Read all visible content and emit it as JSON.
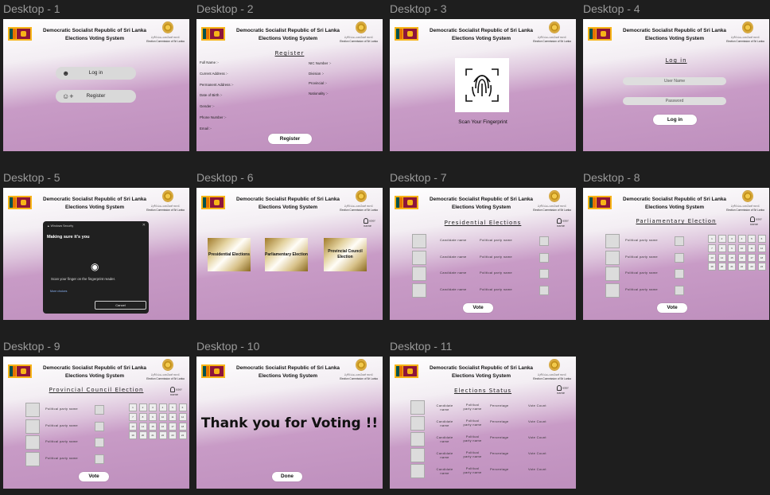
{
  "common": {
    "title_line1": "Democratic Socialist Republic of Sri Lanka",
    "title_line2": "Elections Voting System",
    "commission_si": "මැතිවරණ කොමිෂන් සභාව",
    "commission_en": "Election Commission of Sri Lanka",
    "user_label": "user name"
  },
  "colors": {
    "canvas": "#1e1e1e",
    "frame_top": "#ffffff",
    "frame_bottom": "#be8fbd",
    "label": "#9a9a9a"
  },
  "frames": {
    "d1": {
      "label": "Desktop - 1",
      "login": "Log in",
      "register": "Register",
      "login_icon": "user-icon",
      "register_icon": "add-user-icon"
    },
    "d2": {
      "label": "Desktop - 2",
      "heading": "Register",
      "left_fields": [
        "Full Name :-",
        "Current Address :-",
        "Permanent Address :-",
        "Date of Birth :-",
        "Gender :-",
        "Phone Number :-",
        "Email :-"
      ],
      "right_fields": [
        "NIC Number :-",
        "Division :-",
        "Provincial :-",
        "Nationality :-"
      ],
      "button": "Register"
    },
    "d3": {
      "label": "Desktop - 3",
      "caption": "Scan Your Fingerprint",
      "icon": "fingerprint-icon"
    },
    "d4": {
      "label": "Desktop - 4",
      "heading": "Log in",
      "username_placeholder": "User Name",
      "password_placeholder": "Password",
      "button": "Log in"
    },
    "d5": {
      "label": "Desktop - 5",
      "dialog_app": "Windows Security",
      "dialog_title": "Making sure it's you",
      "dialog_msg": "Scan your finger on the fingerprint reader.",
      "more_choices": "More choices",
      "cancel": "Cancel"
    },
    "d6": {
      "label": "Desktop - 6",
      "cards": [
        "Presidential Elections",
        "Parliamentary Election",
        "Provincial Council Election"
      ]
    },
    "d7": {
      "label": "Desktop - 7",
      "heading": "Presidential Elections",
      "rows": [
        {
          "candidate": "Candidate name",
          "party": "Political party name"
        },
        {
          "candidate": "Candidate name",
          "party": "Political party name"
        },
        {
          "candidate": "Candidate name",
          "party": "Political party name"
        },
        {
          "candidate": "Candidate name",
          "party": "Political party name"
        }
      ],
      "button": "Vote"
    },
    "d8": {
      "label": "Desktop - 8",
      "heading": "Parliamentary Election",
      "parties": [
        "Political party name",
        "Political party name",
        "Political party name",
        "Political party name"
      ],
      "numbers": [
        "1",
        "2",
        "3",
        "4",
        "5",
        "6",
        "7",
        "8",
        "9",
        "10",
        "11",
        "12",
        "13",
        "14",
        "15",
        "16",
        "17",
        "18",
        "19",
        "20",
        "21",
        "22",
        "23",
        "24"
      ],
      "button": "Vote"
    },
    "d9": {
      "label": "Desktop - 9",
      "heading": "Provincial Council Election",
      "parties": [
        "Political party name",
        "Political party name",
        "Political party name",
        "Political party name"
      ],
      "numbers": [
        "1",
        "2",
        "3",
        "4",
        "5",
        "6",
        "7",
        "8",
        "9",
        "10",
        "11",
        "12",
        "13",
        "14",
        "15",
        "16",
        "17",
        "18",
        "19",
        "20",
        "21",
        "22",
        "23",
        "24"
      ],
      "button": "Vote"
    },
    "d10": {
      "label": "Desktop - 10",
      "message": "Thank you for Voting !!",
      "button": "Done"
    },
    "d11": {
      "label": "Desktop - 11",
      "heading": "Elections Status",
      "rows": [
        {
          "candidate": "Candidate name",
          "party": "Political party name",
          "pct": "Percentage",
          "count": "Vote Count"
        },
        {
          "candidate": "Candidate name",
          "party": "Political party name",
          "pct": "Percentage",
          "count": "Vote Count"
        },
        {
          "candidate": "Candidate name",
          "party": "Political party name",
          "pct": "Percentage",
          "count": "Vote Count"
        },
        {
          "candidate": "Candidate name",
          "party": "Political party name",
          "pct": "Percentage",
          "count": "Vote Count"
        },
        {
          "candidate": "Candidate name",
          "party": "Political party name",
          "pct": "Percentage",
          "count": "Vote Count"
        }
      ]
    }
  }
}
